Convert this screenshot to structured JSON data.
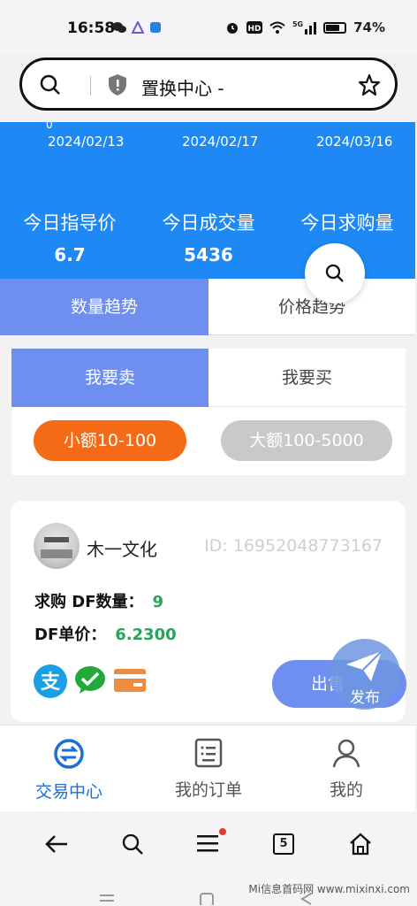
{
  "status_bar": {
    "time": "16:58",
    "battery_text": "74%",
    "battery_level_percent": 74,
    "network_label": "5G"
  },
  "address_bar": {
    "title": "置换中心 -"
  },
  "chart_strip": {
    "axis_zero": "0",
    "dates": [
      "2024/02/13",
      "2024/02/17",
      "2024/03/16"
    ]
  },
  "stats": [
    {
      "label": "今日指导价",
      "value": "6.7"
    },
    {
      "label": "今日成交量",
      "value": "5436"
    },
    {
      "label": "今日求购量",
      "value": ""
    }
  ],
  "trend_tabs": {
    "quantity": "数量趋势",
    "price": "价格趋势"
  },
  "trade_tabs": {
    "sell": "我要卖",
    "buy": "我要买"
  },
  "amount_filters": {
    "small": "小额10-100",
    "large": "大额100-5000"
  },
  "listing": {
    "seller_name": "木一文化",
    "seller_id": "ID: 16952048773167",
    "quantity_label": "求购 DF数量：",
    "quantity_value": "9",
    "price_label": "DF单价：",
    "price_value": "6.2300",
    "action_label": "出售",
    "payment_methods": [
      "alipay-icon",
      "wechat-pay-icon",
      "bank-card-icon"
    ]
  },
  "fab_publish": {
    "label": "发布"
  },
  "bottom_nav": [
    {
      "label": "交易中心",
      "icon": "exchange-icon",
      "active": true
    },
    {
      "label": "我的订单",
      "icon": "orders-icon",
      "active": false
    },
    {
      "label": "我的",
      "icon": "profile-icon",
      "active": false
    }
  ],
  "browser_bar": {
    "tab_count": "5"
  },
  "watermark": "Mi信息首码网 www.mixinxi.com",
  "colors": {
    "primary_blue": "#1e88f5",
    "tab_active": "#6e8ef0",
    "orange": "#f46a16",
    "green_value": "#2aa35a"
  }
}
